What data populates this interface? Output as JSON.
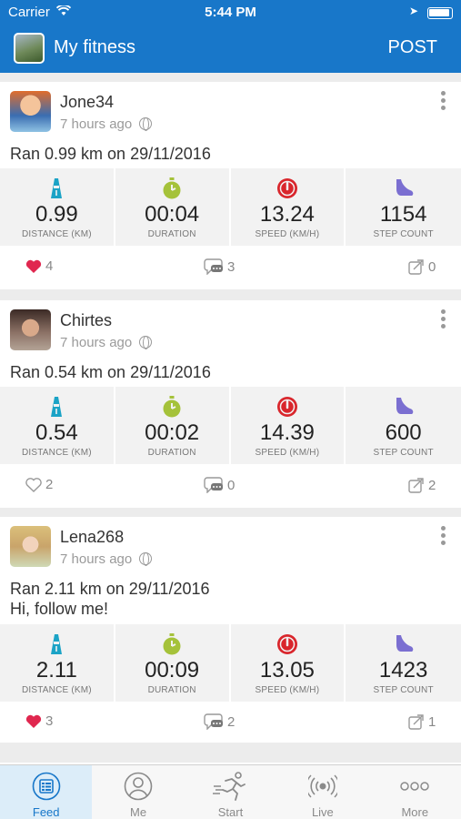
{
  "status_bar": {
    "carrier": "Carrier",
    "time": "5:44 PM"
  },
  "nav": {
    "title": "My fitness",
    "post_label": "POST"
  },
  "colors": {
    "brand": "#1877c9",
    "distance": "#1ba3c6",
    "duration": "#a5c23a",
    "speed": "#d9262c",
    "steps": "#7b6fd1",
    "like": "#e0274f"
  },
  "stat_labels": {
    "distance": "DISTANCE (KM)",
    "duration": "DURATION",
    "speed": "SPEED (KM/H)",
    "steps": "STEP COUNT"
  },
  "posts": [
    {
      "user": "Jone34",
      "time_ago": "7 hours ago",
      "text": "Ran 0.99 km on 29/11/2016",
      "distance": "0.99",
      "duration": "00:04",
      "speed": "13.24",
      "steps": "1154",
      "likes": "4",
      "liked": true,
      "comments": "3",
      "shares": "0"
    },
    {
      "user": "Chirtes",
      "time_ago": "7 hours ago",
      "text": "Ran 0.54 km on 29/11/2016",
      "distance": "0.54",
      "duration": "00:02",
      "speed": "14.39",
      "steps": "600",
      "likes": "2",
      "liked": false,
      "comments": "0",
      "shares": "2"
    },
    {
      "user": "Lena268",
      "time_ago": "7 hours ago",
      "text": "Ran 2.11 km on 29/11/2016",
      "text2": "Hi, follow me!",
      "distance": "2.11",
      "duration": "00:09",
      "speed": "13.05",
      "steps": "1423",
      "likes": "3",
      "liked": true,
      "comments": "2",
      "shares": "1"
    }
  ],
  "tabs": [
    {
      "label": "Feed",
      "icon": "feed-icon",
      "active": true
    },
    {
      "label": "Me",
      "icon": "person-icon",
      "active": false
    },
    {
      "label": "Start",
      "icon": "runner-icon",
      "active": false
    },
    {
      "label": "Live",
      "icon": "broadcast-icon",
      "active": false
    },
    {
      "label": "More",
      "icon": "more-dots-icon",
      "active": false
    }
  ]
}
